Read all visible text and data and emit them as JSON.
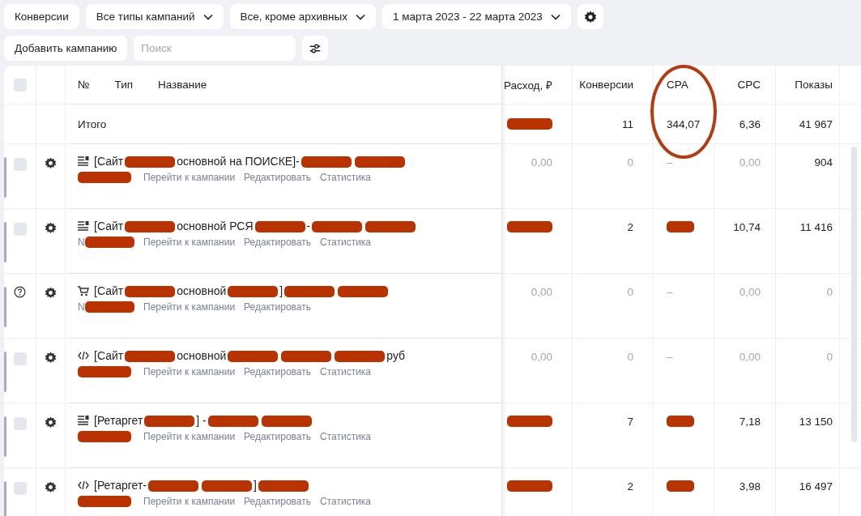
{
  "toolbar": {
    "filters": [
      {
        "label": "Конверсии",
        "dropdown": false
      },
      {
        "label": "Все типы кампаний",
        "dropdown": true
      },
      {
        "label": "Все, кроме архивных",
        "dropdown": true
      },
      {
        "label": "1 марта 2023 - 22 марта 2023",
        "dropdown": true
      }
    ],
    "add_button": "Добавить кампанию",
    "search": {
      "placeholder": "Поиск"
    }
  },
  "table": {
    "select_all": {
      "checked": false
    },
    "name_headers": [
      "№",
      "Тип",
      "Название"
    ],
    "columns": [
      "Расход, ₽",
      "Конверсии",
      "CPA",
      "CPC",
      "Показы"
    ],
    "total": {
      "label": "Итого",
      "cells": [
        {
          "kind": "redacted"
        },
        {
          "kind": "text",
          "text": "11",
          "muted": false
        },
        {
          "kind": "text",
          "text": "344,07",
          "muted": false
        },
        {
          "kind": "text",
          "text": "6,36",
          "muted": false
        },
        {
          "kind": "text",
          "text": "41 967",
          "muted": false
        }
      ]
    },
    "rows": [
      {
        "status": {
          "kind": "checkbox",
          "checked": false
        },
        "type_icon": {
          "kind": "text"
        },
        "name": [
          {
            "kind": "text",
            "text": "[Сайт"
          },
          {
            "kind": "redacted"
          },
          {
            "kind": "text",
            "text": "основной на ПОИСКЕ]-"
          },
          {
            "kind": "redacted"
          },
          {
            "kind": "redacted"
          }
        ],
        "number": [
          {
            "kind": "redacted"
          }
        ],
        "links": [
          "Перейти к кампании",
          "Редактировать",
          "Статистика"
        ],
        "cells": [
          {
            "kind": "text",
            "text": "0,00",
            "muted": true
          },
          {
            "kind": "text",
            "text": "0",
            "muted": true
          },
          {
            "kind": "text",
            "text": "–",
            "muted": true
          },
          {
            "kind": "text",
            "text": "0,00",
            "muted": true
          },
          {
            "kind": "text",
            "text": "904",
            "muted": false
          }
        ]
      },
      {
        "status": {
          "kind": "checkbox",
          "checked": false
        },
        "type_icon": {
          "kind": "text"
        },
        "name": [
          {
            "kind": "text",
            "text": "[Сайт"
          },
          {
            "kind": "redacted"
          },
          {
            "kind": "text",
            "text": "основной РСЯ"
          },
          {
            "kind": "redacted"
          },
          {
            "kind": "text",
            "text": "-"
          },
          {
            "kind": "redacted"
          },
          {
            "kind": "redacted"
          }
        ],
        "number": [
          {
            "kind": "text",
            "text": "N"
          },
          {
            "kind": "redacted"
          }
        ],
        "links": [
          "Перейти к кампании",
          "Редактировать",
          "Статистика"
        ],
        "cells": [
          {
            "kind": "redacted"
          },
          {
            "kind": "text",
            "text": "2",
            "muted": false
          },
          {
            "kind": "redacted"
          },
          {
            "kind": "text",
            "text": "10,74",
            "muted": false
          },
          {
            "kind": "text",
            "text": "11 416",
            "muted": false
          }
        ]
      },
      {
        "status": {
          "kind": "help"
        },
        "type_icon": {
          "kind": "cart"
        },
        "name": [
          {
            "kind": "text",
            "text": "[Сайт"
          },
          {
            "kind": "redacted"
          },
          {
            "kind": "text",
            "text": "основной"
          },
          {
            "kind": "redacted"
          },
          {
            "kind": "text",
            "text": "]"
          },
          {
            "kind": "redacted"
          },
          {
            "kind": "redacted"
          }
        ],
        "number": [
          {
            "kind": "text",
            "text": "N"
          },
          {
            "kind": "redacted"
          }
        ],
        "links": [
          "Перейти к кампании",
          "Редактировать"
        ],
        "cells": [
          {
            "kind": "text",
            "text": "0,00",
            "muted": true
          },
          {
            "kind": "text",
            "text": "0",
            "muted": true
          },
          {
            "kind": "text",
            "text": "–",
            "muted": true
          },
          {
            "kind": "text",
            "text": "0,00",
            "muted": true
          },
          {
            "kind": "text",
            "text": "0",
            "muted": true
          }
        ]
      },
      {
        "status": {
          "kind": "checkbox",
          "checked": false
        },
        "type_icon": {
          "kind": "code"
        },
        "name": [
          {
            "kind": "text",
            "text": "[Сайт"
          },
          {
            "kind": "redacted"
          },
          {
            "kind": "text",
            "text": "основной"
          },
          {
            "kind": "redacted"
          },
          {
            "kind": "redacted"
          },
          {
            "kind": "redacted"
          },
          {
            "kind": "text",
            "text": "руб"
          }
        ],
        "number": [
          {
            "kind": "redacted"
          }
        ],
        "links": [
          "Перейти к кампании",
          "Редактировать",
          "Статистика"
        ],
        "cells": [
          {
            "kind": "text",
            "text": "0,00",
            "muted": true
          },
          {
            "kind": "text",
            "text": "0",
            "muted": true
          },
          {
            "kind": "text",
            "text": "–",
            "muted": true
          },
          {
            "kind": "text",
            "text": "0,00",
            "muted": true
          },
          {
            "kind": "text",
            "text": "0",
            "muted": true
          }
        ]
      },
      {
        "status": {
          "kind": "checkbox",
          "checked": false
        },
        "type_icon": {
          "kind": "text"
        },
        "name": [
          {
            "kind": "text",
            "text": "[Ретаргет"
          },
          {
            "kind": "redacted"
          },
          {
            "kind": "text",
            "text": "] -"
          },
          {
            "kind": "redacted"
          },
          {
            "kind": "redacted"
          }
        ],
        "number": [
          {
            "kind": "redacted"
          }
        ],
        "links": [
          "Перейти к кампании",
          "Редактировать",
          "Статистика"
        ],
        "cells": [
          {
            "kind": "redacted"
          },
          {
            "kind": "text",
            "text": "7",
            "muted": false
          },
          {
            "kind": "redacted"
          },
          {
            "kind": "text",
            "text": "7,18",
            "muted": false
          },
          {
            "kind": "text",
            "text": "13 150",
            "muted": false
          }
        ]
      },
      {
        "status": {
          "kind": "checkbox",
          "checked": false
        },
        "type_icon": {
          "kind": "code"
        },
        "name": [
          {
            "kind": "text",
            "text": "[Ретаргет-"
          },
          {
            "kind": "redacted"
          },
          {
            "kind": "redacted"
          },
          {
            "kind": "text",
            "text": "]"
          },
          {
            "kind": "redacted"
          }
        ],
        "number": [
          {
            "kind": "redacted"
          }
        ],
        "links": [
          "Перейти к кампании",
          "Редактировать",
          "Статистика"
        ],
        "cells": [
          {
            "kind": "redacted"
          },
          {
            "kind": "text",
            "text": "2",
            "muted": false
          },
          {
            "kind": "redacted"
          },
          {
            "kind": "text",
            "text": "3,98",
            "muted": false
          },
          {
            "kind": "text",
            "text": "16 497",
            "muted": false
          }
        ]
      }
    ]
  },
  "annotation": {
    "kind": "ellipse"
  }
}
